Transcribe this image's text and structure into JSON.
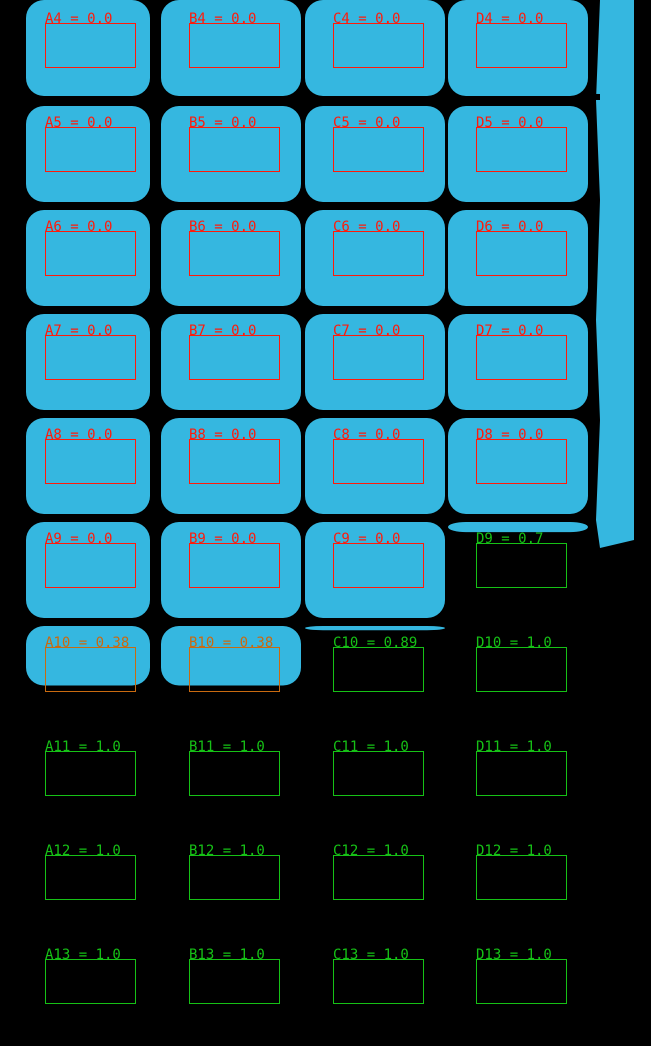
{
  "colors": {
    "background": "#000000",
    "blob": "#35b7e0",
    "status_empty": "#ff1a0a",
    "status_partial": "#c96a10",
    "status_full": "#16c116"
  },
  "grid": {
    "columns": [
      "A",
      "B",
      "C",
      "D"
    ],
    "rows": [
      4,
      5,
      6,
      7,
      8,
      9,
      10,
      11,
      12,
      13
    ],
    "cells": [
      {
        "id": "A4",
        "text": "A4 = 0.0",
        "value": 0.0,
        "status": "empty"
      },
      {
        "id": "B4",
        "text": "B4 = 0.0",
        "value": 0.0,
        "status": "empty"
      },
      {
        "id": "C4",
        "text": "C4 = 0.0",
        "value": 0.0,
        "status": "empty"
      },
      {
        "id": "D4",
        "text": "D4 = 0.0",
        "value": 0.0,
        "status": "empty"
      },
      {
        "id": "A5",
        "text": "A5 = 0.0",
        "value": 0.0,
        "status": "empty"
      },
      {
        "id": "B5",
        "text": "B5 = 0.0",
        "value": 0.0,
        "status": "empty"
      },
      {
        "id": "C5",
        "text": "C5 = 0.0",
        "value": 0.0,
        "status": "empty"
      },
      {
        "id": "D5",
        "text": "D5 = 0.0",
        "value": 0.0,
        "status": "empty"
      },
      {
        "id": "A6",
        "text": "A6 = 0.0",
        "value": 0.0,
        "status": "empty"
      },
      {
        "id": "B6",
        "text": "B6 = 0.0",
        "value": 0.0,
        "status": "empty"
      },
      {
        "id": "C6",
        "text": "C6 = 0.0",
        "value": 0.0,
        "status": "empty"
      },
      {
        "id": "D6",
        "text": "D6 = 0.0",
        "value": 0.0,
        "status": "empty"
      },
      {
        "id": "A7",
        "text": "A7 = 0.0",
        "value": 0.0,
        "status": "empty"
      },
      {
        "id": "B7",
        "text": "B7 = 0.0",
        "value": 0.0,
        "status": "empty"
      },
      {
        "id": "C7",
        "text": "C7 = 0.0",
        "value": 0.0,
        "status": "empty"
      },
      {
        "id": "D7",
        "text": "D7 = 0.0",
        "value": 0.0,
        "status": "empty"
      },
      {
        "id": "A8",
        "text": "A8 = 0.0",
        "value": 0.0,
        "status": "empty"
      },
      {
        "id": "B8",
        "text": "B8 = 0.0",
        "value": 0.0,
        "status": "empty"
      },
      {
        "id": "C8",
        "text": "C8 = 0.0",
        "value": 0.0,
        "status": "empty"
      },
      {
        "id": "D8",
        "text": "D8 = 0.0",
        "value": 0.0,
        "status": "empty"
      },
      {
        "id": "A9",
        "text": "A9 = 0.0",
        "value": 0.0,
        "status": "empty"
      },
      {
        "id": "B9",
        "text": "B9 = 0.0",
        "value": 0.0,
        "status": "empty"
      },
      {
        "id": "C9",
        "text": "C9 = 0.0",
        "value": 0.0,
        "status": "empty"
      },
      {
        "id": "D9",
        "text": "D9 = 0.7",
        "value": 0.7,
        "status": "full"
      },
      {
        "id": "A10",
        "text": "A10 = 0.38",
        "value": 0.38,
        "status": "partial"
      },
      {
        "id": "B10",
        "text": "B10 = 0.38",
        "value": 0.38,
        "status": "partial"
      },
      {
        "id": "C10",
        "text": "C10 = 0.89",
        "value": 0.89,
        "status": "full"
      },
      {
        "id": "D10",
        "text": "D10 = 1.0",
        "value": 1.0,
        "status": "full"
      },
      {
        "id": "A11",
        "text": "A11 = 1.0",
        "value": 1.0,
        "status": "full"
      },
      {
        "id": "B11",
        "text": "B11 = 1.0",
        "value": 1.0,
        "status": "full"
      },
      {
        "id": "C11",
        "text": "C11 = 1.0",
        "value": 1.0,
        "status": "full"
      },
      {
        "id": "D11",
        "text": "D11 = 1.0",
        "value": 1.0,
        "status": "full"
      },
      {
        "id": "A12",
        "text": "A12 = 1.0",
        "value": 1.0,
        "status": "full"
      },
      {
        "id": "B12",
        "text": "B12 = 1.0",
        "value": 1.0,
        "status": "full"
      },
      {
        "id": "C12",
        "text": "C12 = 1.0",
        "value": 1.0,
        "status": "full"
      },
      {
        "id": "D12",
        "text": "D12 = 1.0",
        "value": 1.0,
        "status": "full"
      },
      {
        "id": "A13",
        "text": "A13 = 1.0",
        "value": 1.0,
        "status": "full"
      },
      {
        "id": "B13",
        "text": "B13 = 1.0",
        "value": 1.0,
        "status": "full"
      },
      {
        "id": "C13",
        "text": "C13 = 1.0",
        "value": 1.0,
        "status": "full"
      },
      {
        "id": "D13",
        "text": "D13 = 1.0",
        "value": 1.0,
        "status": "full"
      }
    ]
  }
}
